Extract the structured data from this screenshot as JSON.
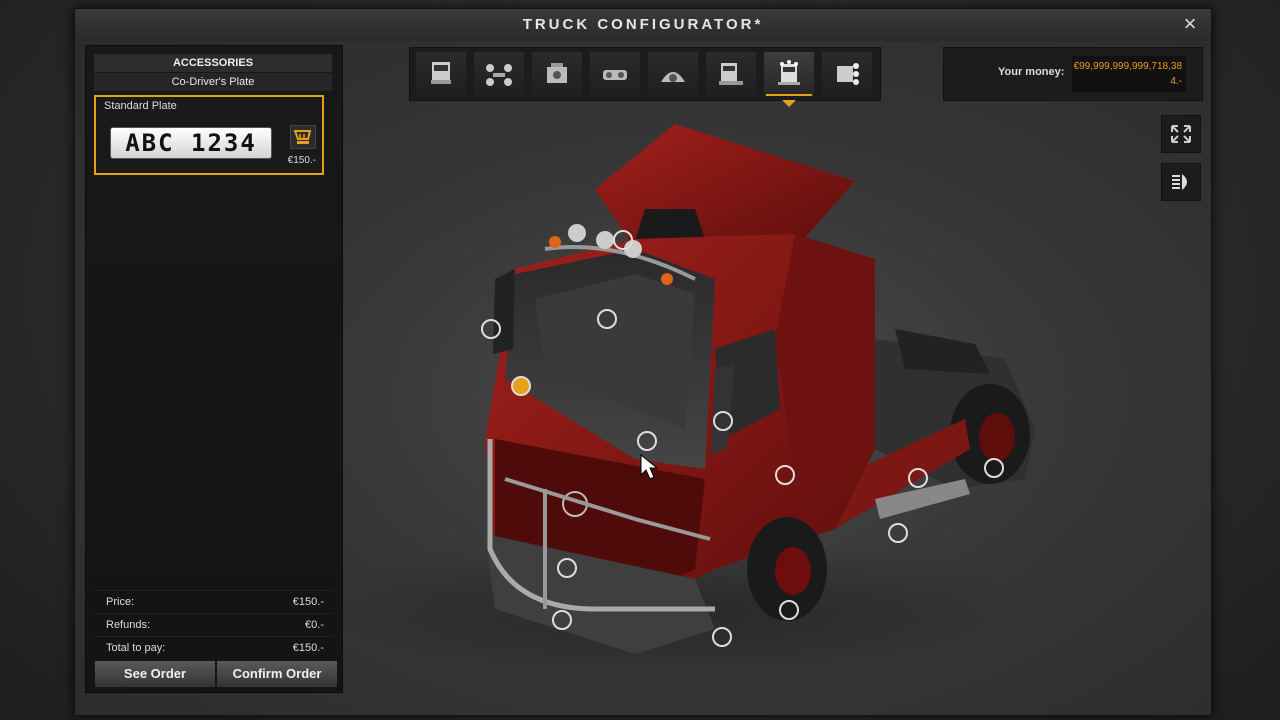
{
  "window": {
    "title": "TRUCK CONFIGURATOR*",
    "close_icon": "×"
  },
  "left_panel": {
    "header": "ACCESSORIES",
    "subheader": "Co-Driver's Plate",
    "item": {
      "title": "Standard Plate",
      "plate_text": "ABC 1234",
      "price": "€150.-"
    },
    "totals": [
      {
        "label": "Price:",
        "value": "€150.-"
      },
      {
        "label": "Refunds:",
        "value": "€0.-"
      },
      {
        "label": "Total to pay:",
        "value": "€150.-"
      }
    ],
    "see_order": "See Order",
    "confirm_order": "Confirm Order"
  },
  "tabs": [
    {
      "icon": "truck-front-icon"
    },
    {
      "icon": "chassis-icon"
    },
    {
      "icon": "engine-icon"
    },
    {
      "icon": "transmission-icon"
    },
    {
      "icon": "interior-icon"
    },
    {
      "icon": "cabin-icon"
    },
    {
      "icon": "accessories-icon",
      "active": true
    },
    {
      "icon": "paint-icon"
    }
  ],
  "money": {
    "label": "Your money:",
    "value": "€99,999,999,999,718,384.-"
  },
  "accent_color": "#e6a11a"
}
